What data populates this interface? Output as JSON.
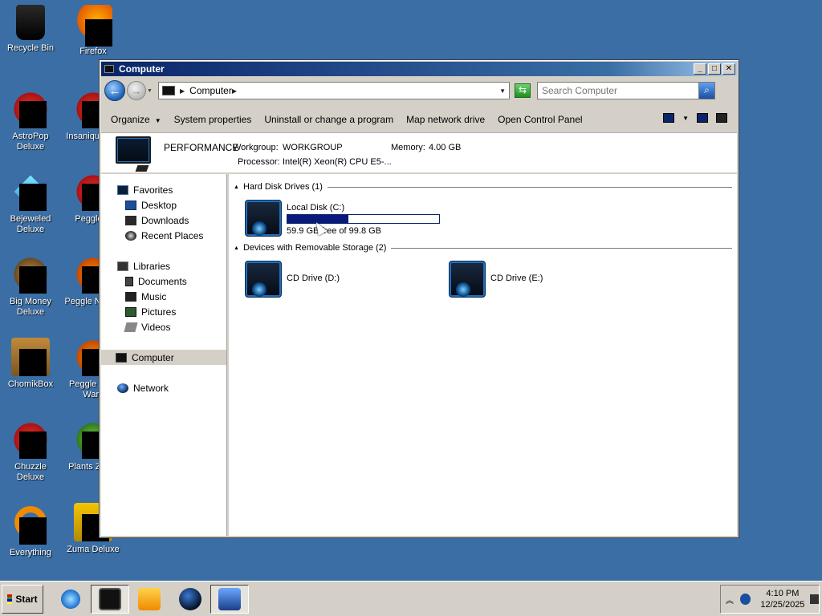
{
  "desktop": {
    "icons": [
      {
        "label": "Recycle Bin",
        "icon": "recycle-bin-icon"
      },
      {
        "label": "Firefox",
        "icon": "firefox-icon"
      },
      {
        "label": "AstroPop Deluxe",
        "icon": "astropop-icon"
      },
      {
        "label": "Insaniquarium Deluxe",
        "icon": "insaniquarium-icon"
      },
      {
        "label": "Bejeweled Deluxe",
        "icon": "bejeweled-icon"
      },
      {
        "label": "Peggle Deluxe",
        "icon": "peggle-icon"
      },
      {
        "label": "Big Money Deluxe",
        "icon": "big-money-icon"
      },
      {
        "label": "Peggle Nights Deluxe",
        "icon": "peggle-nights-icon"
      },
      {
        "label": "ChomikBox",
        "icon": "chomikbox-icon"
      },
      {
        "label": "Peggle World of Warcraft",
        "icon": "peggle-wow-icon"
      },
      {
        "label": "Chuzzle Deluxe",
        "icon": "chuzzle-icon"
      },
      {
        "label": "Plants vs. Zombies",
        "icon": "plants-vs-zombies-icon"
      },
      {
        "label": "Everything",
        "icon": "everything-icon"
      },
      {
        "label": "Zuma Deluxe",
        "icon": "zuma-icon"
      }
    ],
    "visible_labels": {
      "recycle": "Recycle Bin",
      "firefox": "Firefox",
      "astropop": "AstroPop Deluxe",
      "insaniquarium": "Insaniqu Delu",
      "bejeweled": "Bejeweled Deluxe",
      "peggle": "Peggle D",
      "bigmoney": "Big Money Deluxe",
      "pegglenights": "Peggle N Delu",
      "chomikbox": "ChomikBox",
      "pegglewow": "Peggle W of Warc",
      "chuzzle": "Chuzzle Deluxe",
      "plants": "Plants Zomb",
      "everything": "Everything",
      "zuma": "Zuma Deluxe"
    }
  },
  "window": {
    "title": "Computer",
    "controls": {
      "minimize": "_",
      "maximize": "□",
      "close": "✕"
    },
    "address": {
      "location": "Computer"
    },
    "search": {
      "placeholder": "Search Computer"
    },
    "commands": {
      "organize": "Organize",
      "system_properties": "System properties",
      "uninstall": "Uninstall or change a program",
      "map_drive": "Map network drive",
      "control_panel": "Open Control Panel"
    },
    "details": {
      "name": "PERFORMANCE",
      "workgroup_label": "Workgroup:",
      "workgroup_value": "WORKGROUP",
      "memory_label": "Memory:",
      "memory_value": "4.00 GB",
      "processor_label": "Processor:",
      "processor_value": "Intel(R) Xeon(R) CPU E5-..."
    },
    "nav": {
      "favorites": "Favorites",
      "desktop": "Desktop",
      "downloads": "Downloads",
      "recent": "Recent Places",
      "libraries": "Libraries",
      "documents": "Documents",
      "music": "Music",
      "pictures": "Pictures",
      "videos": "Videos",
      "computer": "Computer",
      "network": "Network"
    },
    "groups": {
      "hdd": "Hard Disk Drives (1)",
      "removable": "Devices with Removable Storage (2)"
    },
    "drives": {
      "c": {
        "name": "Local Disk (C:)",
        "free_text": "59.9 GB free of 99.8 GB",
        "used_fraction": 0.4
      },
      "d": {
        "name": "CD Drive (D:)"
      },
      "e": {
        "name": "CD Drive (E:)"
      }
    }
  },
  "taskbar": {
    "start_label": "Start",
    "clock_time": "4:10 PM",
    "clock_date": "12/25/2025"
  }
}
